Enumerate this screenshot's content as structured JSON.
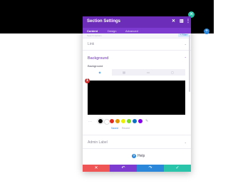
{
  "modal": {
    "title": "Section Settings",
    "header_icons": [
      "close-icon",
      "columns-icon",
      "more-icon"
    ],
    "tabs": [
      {
        "label": "Content",
        "active": true
      },
      {
        "label": "Design",
        "active": false
      },
      {
        "label": "Advanced",
        "active": false
      }
    ],
    "search": {
      "placeholder": "Search Options",
      "filter_label": "+ Filter"
    },
    "panels": {
      "link": {
        "title": "Link",
        "state": "collapsed"
      },
      "background": {
        "title": "Background",
        "state": "expanded",
        "field_label": "Background",
        "type_tabs": [
          {
            "icon": "color-fill-icon",
            "active": true
          },
          {
            "icon": "gradient-icon",
            "active": false
          },
          {
            "icon": "image-icon",
            "active": false
          },
          {
            "icon": "video-icon",
            "active": false
          }
        ],
        "preview_color": "#000000",
        "marker": "1",
        "swatches": [
          "#000000",
          "#ffffff",
          "#e02b20",
          "#e09900",
          "#edf000",
          "#7cda24",
          "#0c71c3",
          "#8300e9"
        ],
        "palette_tabs": {
          "saved": "Saved",
          "recent": "Recent"
        }
      },
      "admin_label": {
        "title": "Admin Label",
        "state": "collapsed"
      }
    },
    "help_label": "Help",
    "footer": [
      {
        "icon": "close-icon",
        "color": "#ef5555"
      },
      {
        "icon": "undo-icon",
        "color": "#7e3bd0"
      },
      {
        "icon": "redo-icon",
        "color": "#2b87da"
      },
      {
        "icon": "check-icon",
        "color": "#29c4a9"
      }
    ]
  },
  "page": {
    "top_bar_color": "#000000",
    "accent": "#6c2eb9"
  }
}
